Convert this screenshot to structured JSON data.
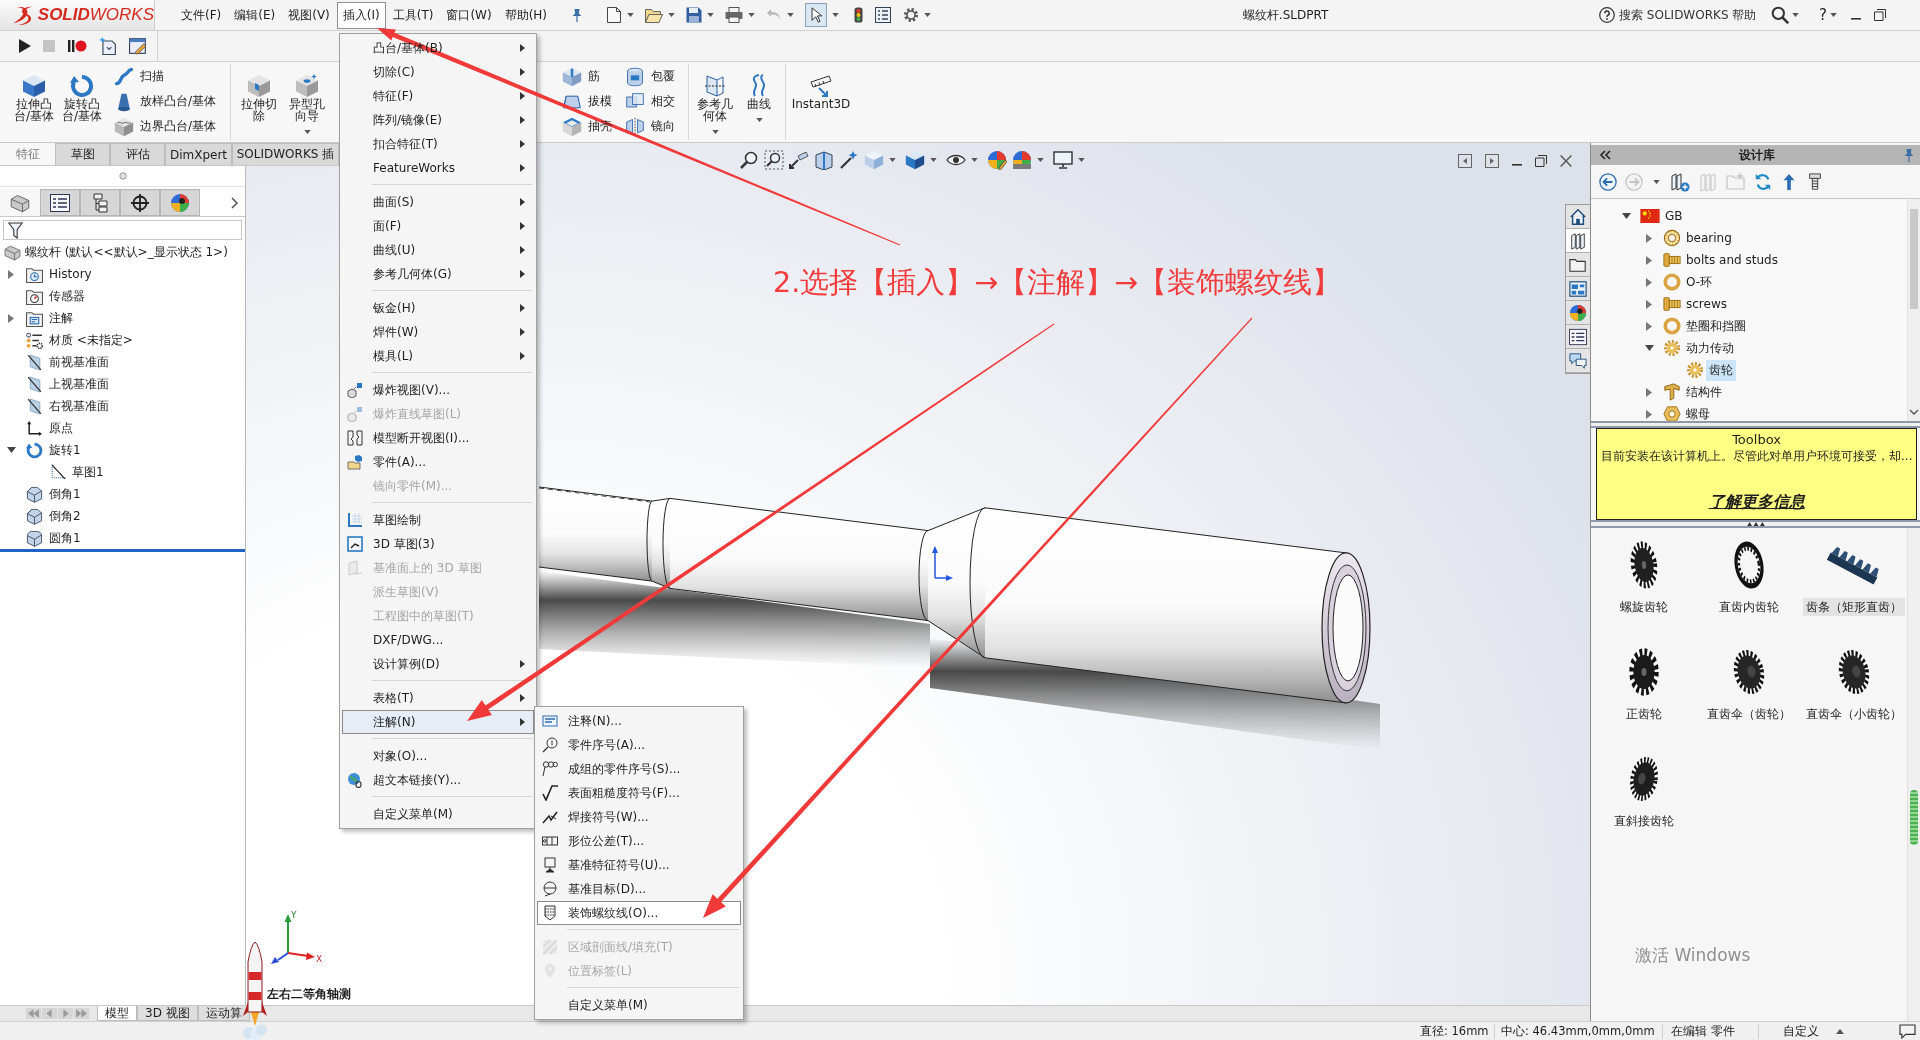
{
  "title_bar": {
    "logo": "**SOLID**WORKS",
    "menus": [
      {
        "label": "文件(F)",
        "selected": false
      },
      {
        "label": "编辑(E)",
        "selected": false
      },
      {
        "label": "视图(V)",
        "selected": false
      },
      {
        "label": "插入(I)",
        "selected": true
      },
      {
        "label": "工具(T)",
        "selected": false
      },
      {
        "label": "窗口(W)",
        "selected": false
      },
      {
        "label": "帮助(H)",
        "selected": false
      }
    ],
    "select_tool_pressed": true,
    "document_title": "螺纹杆.SLDPRT",
    "search": {
      "placeholder": "搜索 SOLIDWORKS 帮助"
    },
    "help": "?"
  },
  "ribbon": {
    "groups": [
      {
        "tools": [
          {
            "kind": "large",
            "label": "拉伸凸台/基体",
            "dropdown": false
          },
          {
            "kind": "large",
            "label": "旋转凸台/基体",
            "dropdown": false
          },
          {
            "kind": "stack",
            "items": [
              "扫描",
              "放样凸台/基体",
              "边界凸台/基体"
            ]
          }
        ]
      },
      {
        "tools": [
          {
            "kind": "large",
            "label": "拉伸切除",
            "dropdown": false
          },
          {
            "kind": "large",
            "label": "异型孔向导",
            "dropdown": true
          }
        ]
      },
      {
        "tools": [
          {
            "kind": "stack",
            "items": [
              "筋",
              "拔模",
              "抽壳"
            ]
          },
          {
            "kind": "stack",
            "items": [
              "包覆",
              "相交",
              "镜向"
            ]
          }
        ]
      },
      {
        "tools": [
          {
            "kind": "large",
            "label": "参考几何体",
            "dropdown": true
          },
          {
            "kind": "large",
            "label": "曲线",
            "dropdown": true
          }
        ]
      },
      {
        "tools": [
          {
            "kind": "large",
            "label": "Instant3D",
            "dropdown": false
          }
        ]
      }
    ],
    "tabs": [
      {
        "label": "特征",
        "selected": true
      },
      {
        "label": "草图",
        "selected": false
      },
      {
        "label": "评估",
        "selected": false
      },
      {
        "label": "DimXpert",
        "selected": false
      },
      {
        "label": "SOLIDWORKS 插",
        "selected": false
      }
    ]
  },
  "feature_tree": {
    "tabs": [
      {
        "selected": true
      },
      {
        "selected": false
      },
      {
        "selected": false
      },
      {
        "selected": false
      },
      {
        "selected": false
      }
    ],
    "root": "螺纹杆 (默认<<默认>_显示状态 1>)",
    "items": [
      {
        "kind": "history",
        "label": "History",
        "expandable": true,
        "expanded": false
      },
      {
        "kind": "sensor",
        "label": "传感器",
        "expandable": false,
        "expanded": false
      },
      {
        "kind": "annotation",
        "label": "注解",
        "expandable": true,
        "expanded": false
      },
      {
        "kind": "material",
        "label": "材质 <未指定>",
        "expandable": false,
        "expanded": false
      },
      {
        "kind": "plane",
        "label": "前视基准面",
        "expandable": false,
        "expanded": false
      },
      {
        "kind": "plane",
        "label": "上视基准面",
        "expandable": false,
        "expanded": false
      },
      {
        "kind": "plane",
        "label": "右视基准面",
        "expandable": false,
        "expanded": false
      },
      {
        "kind": "origin",
        "label": "原点",
        "expandable": false,
        "expanded": false
      },
      {
        "kind": "revolve",
        "label": "旋转1",
        "expandable": true,
        "expanded": true,
        "children": [
          {
            "kind": "sketch",
            "label": "草图1",
            "expandable": false,
            "expanded": false
          }
        ]
      },
      {
        "kind": "chamfer",
        "label": "倒角1",
        "expandable": false,
        "expanded": false
      },
      {
        "kind": "chamfer",
        "label": "倒角2",
        "expandable": false,
        "expanded": false
      },
      {
        "kind": "fillet",
        "label": "圆角1",
        "expandable": false,
        "expanded": false
      }
    ]
  },
  "viewport": {
    "view_label": "左右二等角轴测",
    "triad": {
      "x": "X",
      "y": "Y"
    }
  },
  "task_pane": [
    {
      "selected": false
    },
    {
      "selected": true
    },
    {
      "selected": false
    },
    {
      "selected": false
    },
    {
      "selected": false
    },
    {
      "selected": false
    },
    {
      "selected": false
    }
  ],
  "design_library": {
    "title": "设计库",
    "tree": [
      {
        "kind": "flag",
        "label": "GB",
        "expandable": true,
        "expanded": true,
        "selected": false,
        "children": [
          {
            "kind": "bearing",
            "label": "bearing",
            "expandable": true,
            "expanded": false,
            "selected": false
          },
          {
            "kind": "bolt",
            "label": "bolts and studs",
            "expandable": true,
            "expanded": false,
            "selected": false
          },
          {
            "kind": "ring",
            "label": "O-环",
            "expandable": true,
            "expanded": false,
            "selected": false
          },
          {
            "kind": "bolt",
            "label": "screws",
            "expandable": true,
            "expanded": false,
            "selected": false
          },
          {
            "kind": "ring",
            "label": "垫圈和挡圈",
            "expandable": true,
            "expanded": false,
            "selected": false
          },
          {
            "kind": "gear",
            "label": "动力传动",
            "expandable": true,
            "expanded": true,
            "selected": false,
            "children": [
              {
                "kind": "gear",
                "label": "齿轮",
                "expandable": false,
                "expanded": false,
                "selected": true
              }
            ]
          },
          {
            "kind": "beam",
            "label": "结构件",
            "expandable": true,
            "expanded": false,
            "selected": false
          },
          {
            "kind": "nut",
            "label": "螺母",
            "expandable": true,
            "expanded": false,
            "selected": false
          }
        ]
      }
    ],
    "notice": {
      "title": "Toolbox",
      "text": "目前安装在该计算机上。尽管此对单用户环境可接受，却...",
      "link": "了解更多信息"
    },
    "gallery": [
      {
        "kind": "helical",
        "label": "螺旋齿轮",
        "selected": false
      },
      {
        "kind": "internal",
        "label": "直齿内齿轮",
        "selected": false
      },
      {
        "kind": "rack",
        "label": "齿条（矩形直齿）",
        "selected": true
      },
      {
        "kind": "spur",
        "label": "正齿轮",
        "selected": false
      },
      {
        "kind": "bevel",
        "label": "直齿伞（齿轮）",
        "selected": false
      },
      {
        "kind": "bevel",
        "label": "直齿伞（小齿轮）",
        "selected": false
      },
      {
        "kind": "miter",
        "label": "直斜接齿轮",
        "selected": false
      }
    ]
  },
  "windows_notice": "激活 Windows",
  "bottom_tabs": [
    {
      "label": "模型",
      "selected": true
    },
    {
      "label": "3D 视图",
      "selected": false
    },
    {
      "label": "运动算",
      "selected": false
    }
  ],
  "status_bar": [
    "直径: 16mm",
    "中心: 46.43mm,0mm,0mm",
    "在编辑 零件",
    "自定义"
  ],
  "insert_menu": {
    "groups": [
      {
        "items": [
          {
            "label": "凸台/基体(B)",
            "submenu": true,
            "disabled": false,
            "selected": false
          },
          {
            "label": "切除(C)",
            "submenu": true,
            "disabled": false,
            "selected": false
          },
          {
            "label": "特征(F)",
            "submenu": true,
            "disabled": false,
            "selected": false
          },
          {
            "label": "阵列/镜像(E)",
            "submenu": true,
            "disabled": false,
            "selected": false
          },
          {
            "label": "扣合特征(T)",
            "submenu": true,
            "disabled": false,
            "selected": false
          },
          {
            "label": "FeatureWorks",
            "submenu": true,
            "disabled": false,
            "selected": false
          }
        ]
      },
      {
        "items": [
          {
            "label": "曲面(S)",
            "submenu": true,
            "disabled": false,
            "selected": false
          },
          {
            "label": "面(F)",
            "submenu": true,
            "disabled": false,
            "selected": false
          },
          {
            "label": "曲线(U)",
            "submenu": true,
            "disabled": false,
            "selected": false
          },
          {
            "label": "参考几何体(G)",
            "submenu": true,
            "disabled": false,
            "selected": false
          }
        ]
      },
      {
        "items": [
          {
            "label": "钣金(H)",
            "submenu": true,
            "disabled": false,
            "selected": false
          },
          {
            "label": "焊件(W)",
            "submenu": true,
            "disabled": false,
            "selected": false
          },
          {
            "label": "模具(L)",
            "submenu": true,
            "disabled": false,
            "selected": false
          }
        ]
      },
      {
        "items": [
          {
            "label": "爆炸视图(V)...",
            "submenu": false,
            "disabled": false,
            "selected": false
          },
          {
            "label": "爆炸直线草图(L)",
            "submenu": false,
            "disabled": true,
            "selected": false
          },
          {
            "label": "模型断开视图(I)...",
            "submenu": false,
            "disabled": false,
            "selected": false
          },
          {
            "label": "零件(A)...",
            "submenu": false,
            "disabled": false,
            "selected": false
          },
          {
            "label": "镜向零件(M)...",
            "submenu": false,
            "disabled": true,
            "selected": false
          }
        ]
      },
      {
        "items": [
          {
            "label": "草图绘制",
            "submenu": false,
            "disabled": false,
            "selected": false
          },
          {
            "label": "3D 草图(3)",
            "submenu": false,
            "disabled": false,
            "selected": false
          },
          {
            "label": "基准面上的 3D 草图",
            "submenu": false,
            "disabled": true,
            "selected": false
          },
          {
            "label": "派生草图(V)",
            "submenu": false,
            "disabled": true,
            "selected": false
          },
          {
            "label": "工程图中的草图(T)",
            "submenu": false,
            "disabled": true,
            "selected": false
          },
          {
            "label": "DXF/DWG...",
            "submenu": false,
            "disabled": false,
            "selected": false
          },
          {
            "label": "设计算例(D)",
            "submenu": true,
            "disabled": false,
            "selected": false
          }
        ]
      },
      {
        "items": [
          {
            "label": "表格(T)",
            "submenu": true,
            "disabled": false,
            "selected": false
          },
          {
            "label": "注解(N)",
            "submenu": true,
            "disabled": false,
            "selected": true
          }
        ]
      },
      {
        "items": [
          {
            "label": "对象(O)...",
            "submenu": false,
            "disabled": false,
            "selected": false
          },
          {
            "label": "超文本链接(Y)...",
            "submenu": false,
            "disabled": false,
            "selected": false
          }
        ]
      },
      {
        "items": [
          {
            "label": "自定义菜单(M)",
            "submenu": false,
            "disabled": false,
            "selected": false
          }
        ]
      }
    ]
  },
  "annotation_submenu": {
    "groups": [
      {
        "items": [
          {
            "label": "注释(N)...",
            "disabled": false,
            "selected": false
          },
          {
            "label": "零件序号(A)...",
            "disabled": false,
            "selected": false
          },
          {
            "label": "成组的零件序号(S)...",
            "disabled": false,
            "selected": false
          },
          {
            "label": "表面粗糙度符号(F)...",
            "disabled": false,
            "selected": false
          },
          {
            "label": "焊接符号(W)...",
            "disabled": false,
            "selected": false
          },
          {
            "label": "形位公差(T)...",
            "disabled": false,
            "selected": false
          },
          {
            "label": "基准特征符号(U)...",
            "disabled": false,
            "selected": false
          },
          {
            "label": "基准目标(D)...",
            "disabled": false,
            "selected": false
          },
          {
            "label": "装饰螺纹线(O)...",
            "disabled": false,
            "selected": true
          }
        ]
      },
      {
        "items": [
          {
            "label": "区域剖面线/填充(T)",
            "disabled": true,
            "selected": false
          },
          {
            "label": "位置标签(L)",
            "disabled": true,
            "selected": false
          }
        ]
      },
      {
        "items": [
          {
            "label": "自定义菜单(M)",
            "disabled": false,
            "selected": false
          }
        ]
      }
    ]
  },
  "annotation": {
    "text": "2.选择【插入】→【注解】→【装饰螺纹线】"
  }
}
